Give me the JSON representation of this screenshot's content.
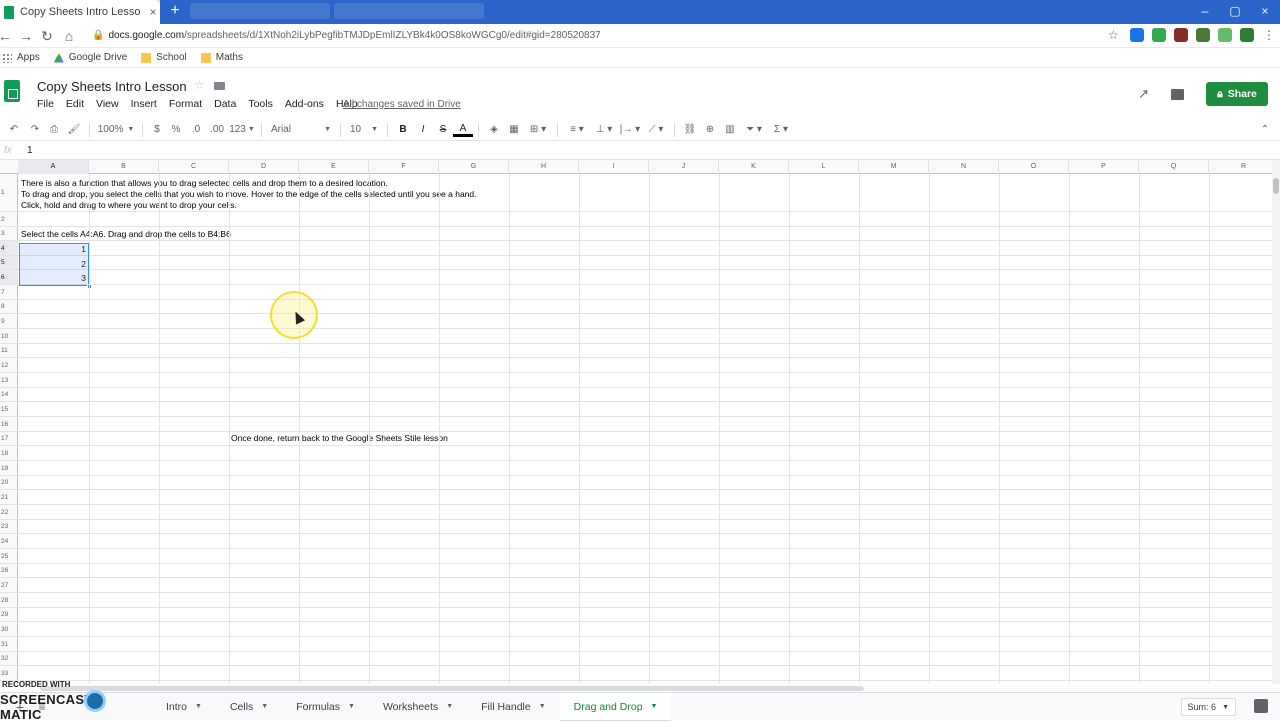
{
  "browser": {
    "tab_title": "Copy Sheets Intro Lesson - Goog",
    "url_host": "docs.google.com",
    "url_path": "/spreadsheets/d/1XtNoh2iLybPegfibTMJDpEmlIZLYBk4k0OS8koWGCg0/edit#gid=280520837",
    "bookmarks": [
      "Apps",
      "Google Drive",
      "School",
      "Maths"
    ]
  },
  "doc": {
    "title": "Copy Sheets Intro Lesson",
    "menus": [
      "File",
      "Edit",
      "View",
      "Insert",
      "Format",
      "Data",
      "Tools",
      "Add-ons",
      "Help"
    ],
    "saved_status": "All changes saved in Drive",
    "share_label": "Share"
  },
  "toolbar": {
    "zoom": "100%",
    "currency": "$",
    "percent": "%",
    "dec_decrease": ".0",
    "dec_increase": ".00",
    "more_formats": "123",
    "font": "Arial",
    "font_size": "10"
  },
  "formula_bar": {
    "fx": "fx",
    "value": "1"
  },
  "grid": {
    "columns": [
      "A",
      "B",
      "C",
      "D",
      "E",
      "F",
      "G",
      "H",
      "I",
      "J",
      "K",
      "L",
      "M",
      "N",
      "O",
      "P",
      "Q",
      "R"
    ],
    "rows": [
      "1",
      "2",
      "3",
      "4",
      "5",
      "6",
      "7",
      "8",
      "9",
      "10",
      "11",
      "12",
      "13",
      "14",
      "15",
      "16",
      "17",
      "18",
      "19",
      "20",
      "21",
      "22",
      "23",
      "24",
      "25",
      "26",
      "27",
      "28",
      "29",
      "30",
      "31",
      "32",
      "33"
    ],
    "cells": {
      "a1_line1": "There is also a function that allows you to drag selected cells and drop them to a desired location.",
      "a1_line2": "To drag and drop, you select the cells that you wish to move. Hover to the edge of the cells selected until you see a hand.",
      "a1_line3": "Click, hold and drag to where you want to drop your cells.",
      "a3": "Select the cells A4:A6. Drag and drop the cells to B4:B6",
      "a4": "1",
      "a5": "2",
      "a6": "3",
      "d17": "Once done, return back to the Google Sheets Stile lesson"
    }
  },
  "sheet_tabs": [
    "Intro",
    "Cells",
    "Formulas",
    "Worksheets",
    "Fill Handle",
    "Drag and Drop"
  ],
  "active_sheet": "Drag and Drop",
  "sum_label": "Sum: 6",
  "watermark": {
    "line1": "RECORDED WITH",
    "line2": "SCREENCAST",
    "line3": "MATIC"
  },
  "colors": {
    "brand_green": "#1e8e3e",
    "selection_blue": "#4285f4",
    "chrome_blue": "#2b65c9"
  }
}
